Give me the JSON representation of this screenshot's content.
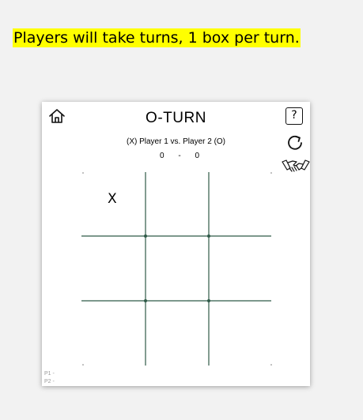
{
  "caption": "Players will take turns, 1 box per turn.",
  "game": {
    "title": "O-TURN",
    "matchup": "(X) Player 1 vs. Player 2 (O)",
    "score": {
      "player1": "0",
      "separator": "-",
      "player2": "0"
    },
    "help_label": "?",
    "icons": {
      "home": "home-icon",
      "help": "help-icon",
      "restart": "restart-icon",
      "draw": "handshake-icon"
    },
    "board": [
      [
        "X",
        "",
        ""
      ],
      [
        "",
        "",
        ""
      ],
      [
        "",
        "",
        ""
      ]
    ],
    "players": {
      "p1": "P1 -",
      "p2": "P2 -"
    },
    "colors": {
      "highlight": "#ffff00",
      "grid": "#2f5a48"
    }
  }
}
